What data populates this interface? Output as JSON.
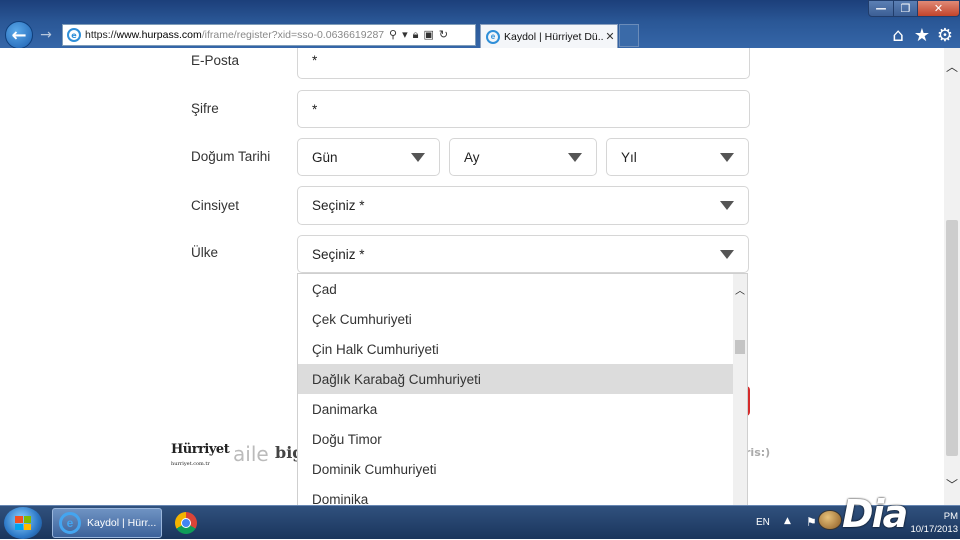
{
  "browser": {
    "address": {
      "scheme": "https://",
      "host": "www.hurpass.com",
      "path": "/iframe/register?xid=sso-0.0636619287"
    },
    "tab": {
      "title": "Kaydol | Hürriyet Dü...",
      "close": "✕"
    },
    "window_controls": {
      "minimize": "—",
      "maximize": "❐",
      "close": "✕"
    }
  },
  "form": {
    "fields": {
      "email": {
        "label": "E-Posta",
        "value": "*"
      },
      "password": {
        "label": "Şifre",
        "value": "*"
      },
      "birthdate": {
        "label": "Doğum Tarihi",
        "day": "Gün",
        "month": "Ay",
        "year": "Yıl"
      },
      "gender": {
        "label": "Cinsiyet",
        "value": "Seçiniz *"
      },
      "country": {
        "label": "Ülke",
        "value": "Seçiniz *"
      }
    },
    "country_options": [
      "Çad",
      "Çek Cumhuriyeti",
      "Çin Halk Cumhuriyeti",
      "Dağlık Karabağ Cumhuriyeti",
      "Danimarka",
      "Doğu Timor",
      "Dominik Cumhuriyeti",
      "Dominika"
    ],
    "highlighted_option": "Dağlık Karabağ Cumhuriyeti"
  },
  "footer_logos": {
    "hurriyet": "Hürriyet",
    "hurriyet_sub": "hurriyet.com.tr",
    "aile": "aile",
    "big": "big",
    "ris": "ris:)"
  },
  "taskbar": {
    "ie_button_label": "Kaydol | Hürr...",
    "language": "EN",
    "watermark": "Dia",
    "clock": {
      "period": "PM",
      "date": "10/17/2013"
    }
  }
}
